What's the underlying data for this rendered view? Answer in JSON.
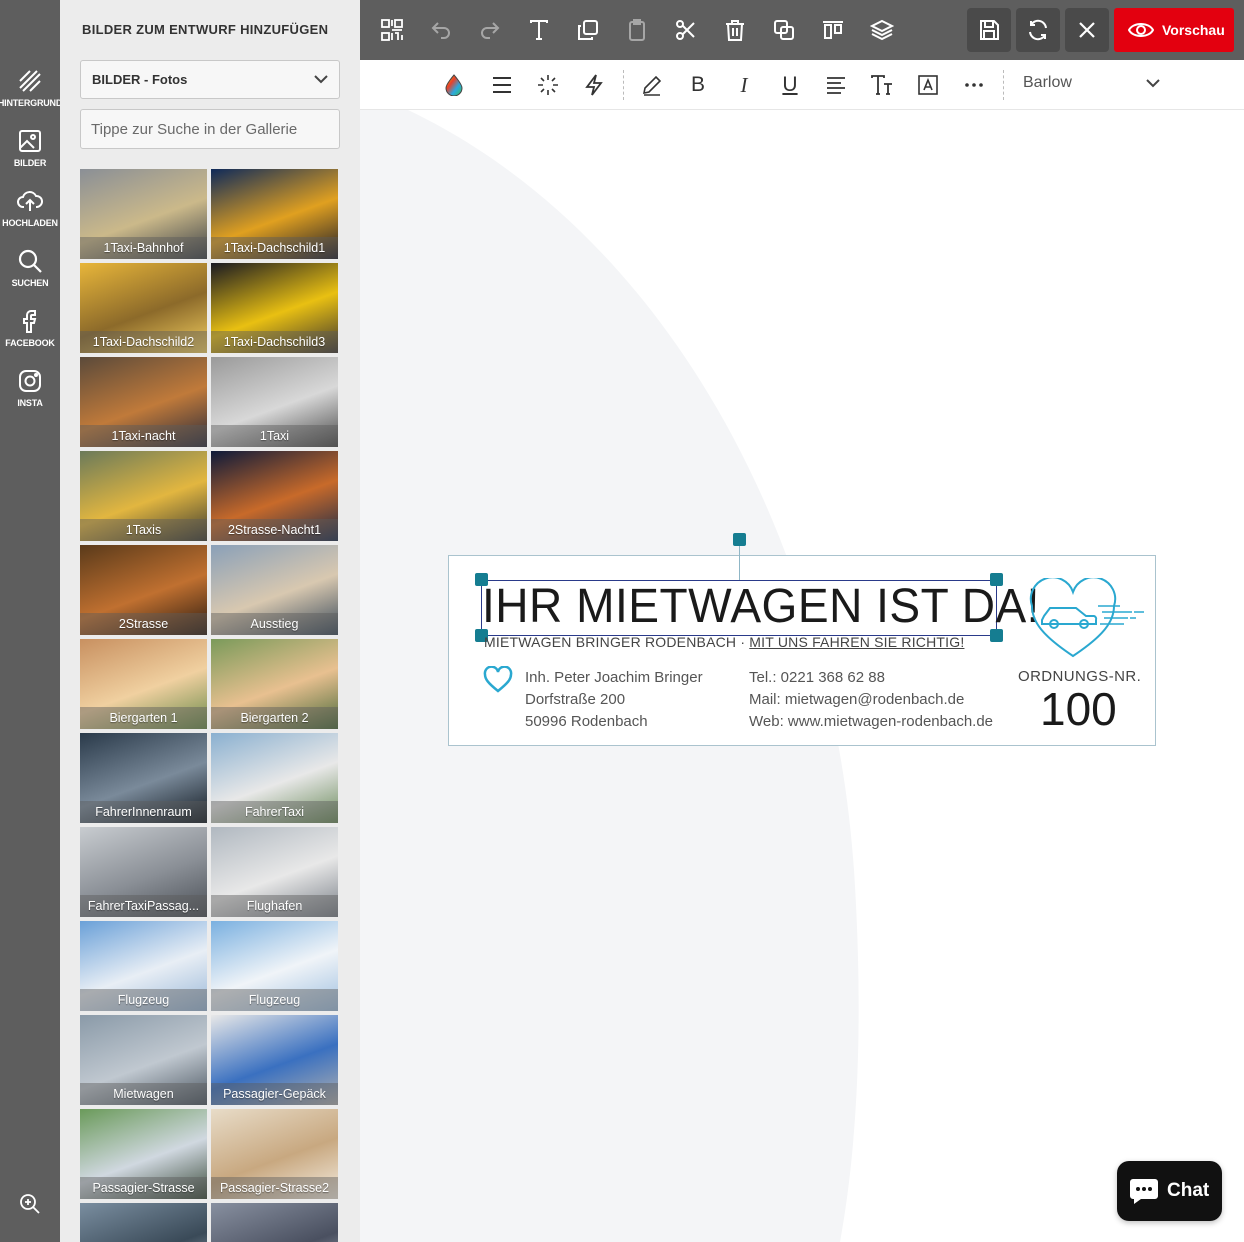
{
  "rail": {
    "items": [
      {
        "label": "Hintergrund",
        "icon": "background-icon"
      },
      {
        "label": "Bilder",
        "icon": "image-icon"
      },
      {
        "label": "Hochladen",
        "icon": "cloud-upload-icon"
      },
      {
        "label": "Suchen",
        "icon": "search-icon"
      },
      {
        "label": "Facebook",
        "icon": "facebook-icon"
      },
      {
        "label": "Insta",
        "icon": "instagram-icon"
      }
    ],
    "active": "Bilder"
  },
  "panel": {
    "title": "Bilder zum Entwurf hinzufügen",
    "category_select": "BILDER - Fotos",
    "search_placeholder": "Tippe zur Suche in der Gallerie",
    "images": [
      {
        "caption": "1Taxi-Bahnhof",
        "colors": [
          "#8a8f96",
          "#cbb98a",
          "#3a3f46"
        ]
      },
      {
        "caption": "1Taxi-Dachschild1",
        "colors": [
          "#0f2a5a",
          "#e0a020",
          "#1c1c2a"
        ]
      },
      {
        "caption": "1Taxi-Dachschild2",
        "colors": [
          "#e8b63a",
          "#8c6a2a",
          "#f4d060"
        ]
      },
      {
        "caption": "1Taxi-Dachschild3",
        "colors": [
          "#1a1a22",
          "#e9c012",
          "#3c3530"
        ]
      },
      {
        "caption": "1Taxi-nacht",
        "colors": [
          "#5b4a3a",
          "#c07a3a",
          "#2a2a3a"
        ]
      },
      {
        "caption": "1Taxi",
        "colors": [
          "#9a9a9a",
          "#d8d8d8",
          "#4a4a4a"
        ]
      },
      {
        "caption": "1Taxis",
        "colors": [
          "#6b7a5a",
          "#e2b640",
          "#3a3a32"
        ]
      },
      {
        "caption": "2Strasse-Nacht1",
        "colors": [
          "#0e1a3a",
          "#c86a2a",
          "#1a2a4a"
        ]
      },
      {
        "caption": "2Strasse",
        "colors": [
          "#5a3a1a",
          "#c07030",
          "#2a1a10"
        ]
      },
      {
        "caption": "Ausstieg",
        "colors": [
          "#8aa0b8",
          "#d8c8b0",
          "#3a4a5a"
        ]
      },
      {
        "caption": "Biergarten 1",
        "colors": [
          "#c89060",
          "#f0d0a0",
          "#6a8a4a"
        ]
      },
      {
        "caption": "Biergarten 2",
        "colors": [
          "#7a9a5a",
          "#e8c090",
          "#4a6a3a"
        ]
      },
      {
        "caption": "FahrerInnenraum",
        "colors": [
          "#2a3a4a",
          "#7a8a9a",
          "#101820"
        ]
      },
      {
        "caption": "FahrerTaxi",
        "colors": [
          "#8ab0d0",
          "#e8e8e8",
          "#6a8a5a"
        ]
      },
      {
        "caption": "FahrerTaxiPassag...",
        "colors": [
          "#c8ccd0",
          "#8a8f96",
          "#4a4f56"
        ]
      },
      {
        "caption": "Flughafen",
        "colors": [
          "#b0b8c0",
          "#e8e8e8",
          "#7a8088"
        ]
      },
      {
        "caption": "Flugzeug",
        "colors": [
          "#6aa0d8",
          "#e8eef5",
          "#9ab8d8"
        ]
      },
      {
        "caption": "Flugzeug",
        "colors": [
          "#7ab0e0",
          "#f0f4f8",
          "#a0c0e0"
        ]
      },
      {
        "caption": "Mietwagen",
        "colors": [
          "#8a9aa8",
          "#c0c8d0",
          "#4a5560"
        ]
      },
      {
        "caption": "Passagier-Gepäck",
        "colors": [
          "#e8e8e8",
          "#3a70c0",
          "#b0b0b0"
        ]
      },
      {
        "caption": "Passagier-Strasse",
        "colors": [
          "#6a9a5a",
          "#d0d8e0",
          "#3a4a3a"
        ]
      },
      {
        "caption": "Passagier-Strasse2",
        "colors": [
          "#e8dcc8",
          "#c8a880",
          "#f4ece0"
        ]
      },
      {
        "caption": "",
        "colors": [
          "#7a8ea0",
          "#3a4a58",
          "#b8c4d0"
        ]
      },
      {
        "caption": "",
        "colors": [
          "#8890a0",
          "#4a5060",
          "#c0c8d4"
        ]
      }
    ]
  },
  "toolbar": {
    "buttons": [
      {
        "name": "qr-code-button",
        "icon": "qr-code-icon",
        "enabled": true
      },
      {
        "name": "undo-button",
        "icon": "undo-icon",
        "enabled": false
      },
      {
        "name": "redo-button",
        "icon": "redo-icon",
        "enabled": false
      },
      {
        "name": "add-text-button",
        "icon": "text-icon",
        "enabled": true
      },
      {
        "name": "copy-button",
        "icon": "copy-icon",
        "enabled": true
      },
      {
        "name": "paste-button",
        "icon": "clipboard-icon",
        "enabled": false
      },
      {
        "name": "cut-button",
        "icon": "scissors-icon",
        "enabled": true
      },
      {
        "name": "delete-button",
        "icon": "trash-icon",
        "enabled": true
      },
      {
        "name": "duplicate-button",
        "icon": "duplicate-icon",
        "enabled": true
      },
      {
        "name": "align-button",
        "icon": "align-icon",
        "enabled": true
      },
      {
        "name": "layers-button",
        "icon": "layers-icon",
        "enabled": true
      }
    ],
    "save_icon": "save-icon",
    "reload_icon": "refresh-icon",
    "close_icon": "close-icon",
    "preview_label": "Vorschau",
    "preview_color": "#e3000f"
  },
  "format_bar": {
    "buttons": [
      "color-drop-icon",
      "line-height-icon",
      "effects-icon",
      "flash-icon",
      "pen-icon",
      "bold-icon",
      "italic-icon",
      "underline-icon",
      "align-left-icon",
      "text-size-icon",
      "text-box-icon",
      "more-icon"
    ],
    "bold_label": "B",
    "italic_label": "I",
    "underline_label": "U",
    "font_family": "Barlow"
  },
  "card": {
    "headline": "IHR MIETWAGEN IST DA!",
    "subline_plain": "MIETWAGEN BRINGER RODENBACH · ",
    "subline_underlined": "MIT UNS FAHREN SIE RICHTIG!",
    "address": [
      "Inh. Peter Joachim Bringer",
      "Dorfstraße 200",
      "50996 Rodenbach"
    ],
    "contact": [
      "Tel.: 0221 368 62 88",
      "Mail: mietwagen@rodenbach.de",
      "Web: www.mietwagen-rodenbach.de"
    ],
    "order_label": "ORDNUNGS-NR.",
    "order_number": "100",
    "accent_color": "#2aa8d0",
    "handle_color": "#157d91"
  },
  "chat": {
    "label": "Chat"
  }
}
